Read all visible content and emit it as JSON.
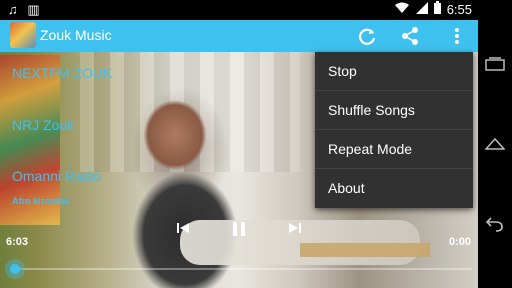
{
  "status_bar": {
    "time": "6:55",
    "icons": [
      "music-note-icon",
      "barcode-icon",
      "wifi-icon",
      "signal-icon",
      "battery-icon"
    ]
  },
  "action_bar": {
    "title": "Zouk Music",
    "icons": [
      "refresh-icon",
      "share-icon",
      "overflow-menu-icon"
    ],
    "color": "#3fc1ef"
  },
  "stations": [
    {
      "label": "NEXTFM ZOUK"
    },
    {
      "label": "NRJ Zouk"
    },
    {
      "label": "Omanni Radio"
    }
  ],
  "genre": "Afro kizomba",
  "menu": {
    "items": [
      "Stop",
      "Shuffle Songs",
      "Repeat Mode",
      "About"
    ]
  },
  "player": {
    "elapsed": "6:03",
    "duration": "0:00",
    "controls": [
      "previous-icon",
      "pause-icon",
      "next-icon"
    ],
    "progress": 0
  },
  "nav_bar": {
    "icons": [
      "recent-apps-icon",
      "home-icon",
      "back-icon"
    ]
  }
}
